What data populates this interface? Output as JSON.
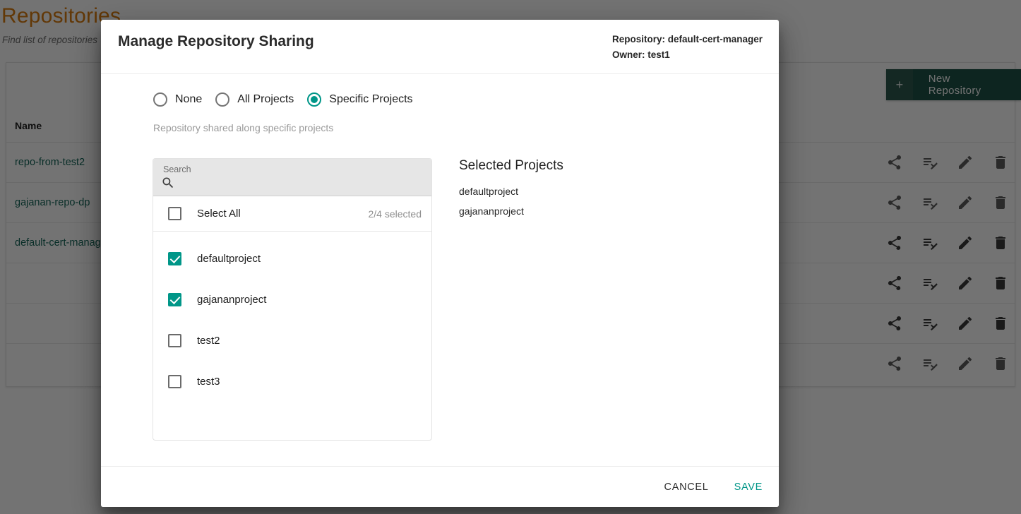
{
  "background": {
    "title": "Repositories",
    "subtitle": "Find list of repositories",
    "new_repository": {
      "plus": "+",
      "label": "New Repository"
    },
    "table": {
      "columns": [
        "Name"
      ],
      "rows": [
        {
          "name": "repo-from-test2"
        },
        {
          "name": "gajanan-repo-dp"
        },
        {
          "name": "default-cert-manager"
        },
        {
          "name": ""
        },
        {
          "name": ""
        },
        {
          "name": ""
        }
      ],
      "row_action_icons": [
        "share-icon",
        "playlist-check-icon",
        "edit-icon",
        "delete-icon"
      ]
    }
  },
  "dialog": {
    "title": "Manage Repository Sharing",
    "repository_line": "Repository: default-cert-manager",
    "owner_line": "Owner: test1",
    "sharing_options": [
      {
        "label": "None",
        "selected": false
      },
      {
        "label": "All Projects",
        "selected": false
      },
      {
        "label": "Specific Projects",
        "selected": true
      }
    ],
    "hint": "Repository shared along specific projects",
    "search": {
      "label": "Search",
      "value": "",
      "placeholder": "",
      "icon": "search-icon"
    },
    "select_all": {
      "label": "Select All",
      "checked": false,
      "count_text": "2/4 selected"
    },
    "projects": [
      {
        "label": "defaultproject",
        "checked": true
      },
      {
        "label": "gajananproject",
        "checked": true
      },
      {
        "label": "test2",
        "checked": false
      },
      {
        "label": "test3",
        "checked": false
      }
    ],
    "selected_panel": {
      "title": "Selected Projects",
      "items": [
        "defaultproject",
        "gajananproject"
      ]
    },
    "footer": {
      "cancel": "CANCEL",
      "save": "SAVE"
    }
  },
  "colors": {
    "accent_teal": "#009688",
    "brand_orange": "#d97c11",
    "repo_link": "#15675a",
    "button_green": "#1d5248"
  }
}
